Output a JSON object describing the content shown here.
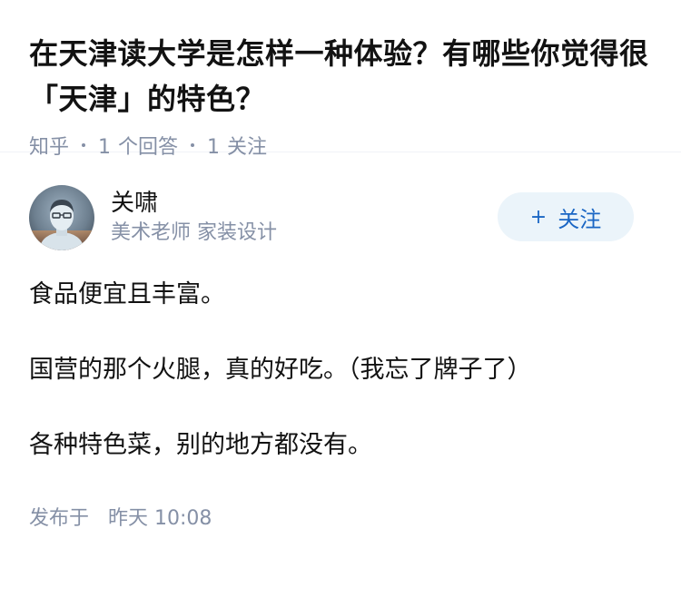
{
  "question": {
    "title": "在天津读大学是怎样一种体验？有哪些你觉得很「天津」的特色？",
    "source": "知乎",
    "answer_count_num": "1",
    "answer_count_label": "个回答",
    "follow_count_num": "1",
    "follow_count_label": "关注"
  },
  "answer": {
    "author": {
      "name": "关啸",
      "bio": "美术老师 家装设计",
      "avatar_icon": "user-avatar"
    },
    "follow_button": {
      "icon": "+",
      "label": "关注"
    },
    "paragraphs": [
      "食品便宜且丰富。",
      "国营的那个火腿，真的好吃。（我忘了牌子了）",
      "各种特色菜，别的地方都没有。"
    ],
    "publish": {
      "prefix": "发布于",
      "time": "昨天 10:08"
    }
  },
  "colors": {
    "text": "#121212",
    "meta": "#8590a6",
    "follow_bg": "#ebf4fa",
    "follow_text": "#1a66c4"
  }
}
